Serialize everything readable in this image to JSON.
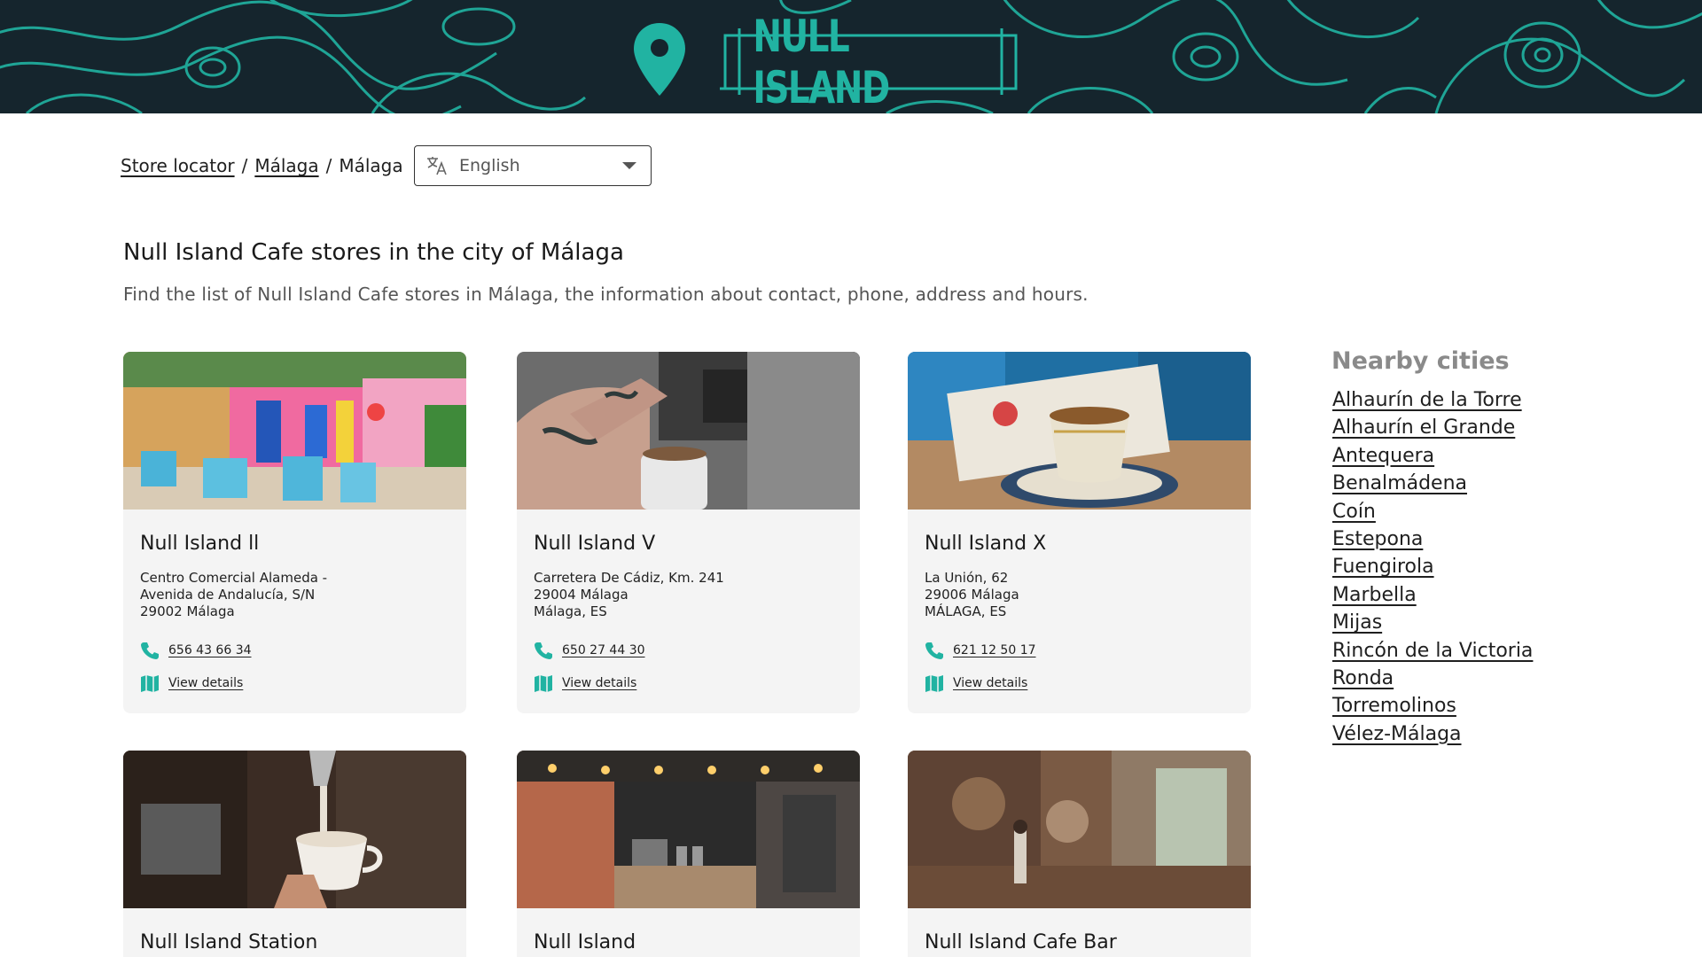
{
  "brand": {
    "name": "NULL ISLAND",
    "accent": "#21b3a2",
    "banner_bg": "#15252d"
  },
  "breadcrumb": {
    "items": [
      "Store locator",
      "Málaga",
      "Málaga"
    ],
    "separator": "/"
  },
  "language": {
    "selected": "English"
  },
  "page": {
    "title": "Null Island Cafe stores in the city of Málaga",
    "subtitle": "Find the list of Null Island Cafe stores in Málaga, the information about contact, phone, address and hours."
  },
  "stores": [
    {
      "name": "Null Island ll",
      "address": [
        "Centro Comercial Alameda -",
        "Avenida de Andalucía, S/N",
        "29002 Málaga"
      ],
      "phone": "656 43 66 34",
      "details": "View details"
    },
    {
      "name": "Null Island V",
      "address": [
        "Carretera De Cádiz, Km. 241",
        "29004 Málaga",
        "Málaga, ES"
      ],
      "phone": "650 27 44 30",
      "details": "View details"
    },
    {
      "name": "Null Island X",
      "address": [
        "La Unión, 62",
        "29006 Málaga",
        "MÁLAGA, ES"
      ],
      "phone": "621 12 50 17",
      "details": "View details"
    },
    {
      "name": "Null Island Station"
    },
    {
      "name": "Null Island"
    },
    {
      "name": "Null Island Cafe Bar"
    }
  ],
  "nearby": {
    "title": "Nearby cities",
    "cities": [
      "Alhaurín de la Torre",
      "Alhaurín el Grande",
      "Antequera",
      "Benalmádena",
      "Coín",
      "Estepona",
      "Fuengirola",
      "Marbella",
      "Mijas",
      "Rincón de la Victoria",
      "Ronda",
      "Torremolinos",
      "Vélez-Málaga"
    ]
  }
}
